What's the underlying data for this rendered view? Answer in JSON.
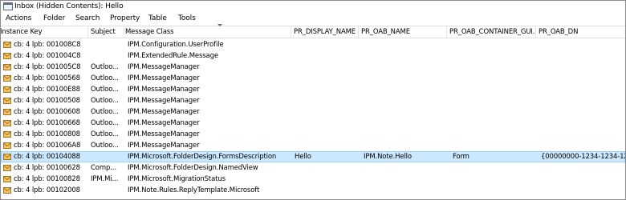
{
  "window": {
    "title": "Inbox (Hidden Contents): Hello"
  },
  "menu": {
    "items": [
      "Actions",
      "Folder",
      "Search",
      "Property",
      "Table",
      "Tools"
    ]
  },
  "table": {
    "columns": [
      "Instance Key",
      "Subject",
      "Message Class",
      "PR_DISPLAY_NAME",
      "PR_OAB_NAME",
      "PR_OAB_CONTAINER_GUI...",
      "PR_OAB_DN"
    ],
    "rows": [
      {
        "key": "cb: 4 lpb: 001008C8",
        "subject": "",
        "message_class": "IPM.Configuration.UserProfile",
        "display_name": "",
        "oab_name": "",
        "oab_container_guid": "",
        "oab_dn": "",
        "selected": false
      },
      {
        "key": "cb: 4 lpb: 001004C8",
        "subject": "",
        "message_class": "IPM.ExtendedRule.Message",
        "display_name": "",
        "oab_name": "",
        "oab_container_guid": "",
        "oab_dn": "",
        "selected": false
      },
      {
        "key": "cb: 4 lpb: 001005C8",
        "subject": "Outloo...",
        "message_class": "IPM.MessageManager",
        "display_name": "",
        "oab_name": "",
        "oab_container_guid": "",
        "oab_dn": "",
        "selected": false
      },
      {
        "key": "cb: 4 lpb: 00100568",
        "subject": "Outloo...",
        "message_class": "IPM.MessageManager",
        "display_name": "",
        "oab_name": "",
        "oab_container_guid": "",
        "oab_dn": "",
        "selected": false
      },
      {
        "key": "cb: 4 lpb: 00100E88",
        "subject": "Outloo...",
        "message_class": "IPM.MessageManager",
        "display_name": "",
        "oab_name": "",
        "oab_container_guid": "",
        "oab_dn": "",
        "selected": false
      },
      {
        "key": "cb: 4 lpb: 00100508",
        "subject": "Outloo...",
        "message_class": "IPM.MessageManager",
        "display_name": "",
        "oab_name": "",
        "oab_container_guid": "",
        "oab_dn": "",
        "selected": false
      },
      {
        "key": "cb: 4 lpb: 00100608",
        "subject": "Outloo...",
        "message_class": "IPM.MessageManager",
        "display_name": "",
        "oab_name": "",
        "oab_container_guid": "",
        "oab_dn": "",
        "selected": false
      },
      {
        "key": "cb: 4 lpb: 00100668",
        "subject": "Outloo...",
        "message_class": "IPM.MessageManager",
        "display_name": "",
        "oab_name": "",
        "oab_container_guid": "",
        "oab_dn": "",
        "selected": false
      },
      {
        "key": "cb: 4 lpb: 00100808",
        "subject": "Outloo...",
        "message_class": "IPM.MessageManager",
        "display_name": "",
        "oab_name": "",
        "oab_container_guid": "",
        "oab_dn": "",
        "selected": false
      },
      {
        "key": "cb: 4 lpb: 001006A8",
        "subject": "Outloo...",
        "message_class": "IPM.MessageManager",
        "display_name": "",
        "oab_name": "",
        "oab_container_guid": "",
        "oab_dn": "",
        "selected": false
      },
      {
        "key": "cb: 4 lpb: 00104088",
        "subject": "",
        "message_class": "IPM.Microsoft.FolderDesign.FormsDescription",
        "display_name": "Hello",
        "oab_name": "IPM.Note.Hello",
        "oab_container_guid": "Form",
        "oab_dn": "{00000000-1234-1234-12...",
        "selected": true
      },
      {
        "key": "cb: 4 lpb: 00100628",
        "subject": "Comp...",
        "message_class": "IPM.Microsoft.FolderDesign.NamedView",
        "display_name": "",
        "oab_name": "",
        "oab_container_guid": "",
        "oab_dn": "",
        "selected": false
      },
      {
        "key": "cb: 4 lpb: 00100828",
        "subject": "IPM.Mi...",
        "message_class": "IPM.Microsoft.MigrationStatus",
        "display_name": "",
        "oab_name": "",
        "oab_container_guid": "",
        "oab_dn": "",
        "selected": false
      },
      {
        "key": "cb: 4 lpb: 00102008",
        "subject": "",
        "message_class": "IPM.Note.Rules.ReplyTemplate.Microsoft",
        "display_name": "",
        "oab_name": "",
        "oab_container_guid": "",
        "oab_dn": "",
        "selected": false
      }
    ]
  },
  "icons": {
    "app": "window-app-icon",
    "row": "envelope-icon"
  },
  "colors": {
    "selected_row": "#cce8ff",
    "selected_border": "#99d1ff",
    "envelope_fill": "#f3c35f",
    "envelope_stroke": "#8a5a10"
  }
}
